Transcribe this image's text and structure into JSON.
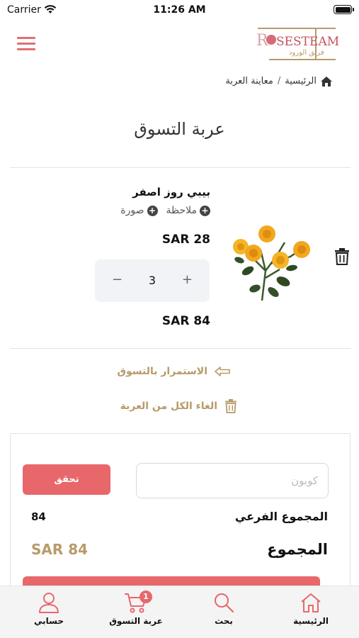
{
  "status_bar": {
    "carrier": "Carrier",
    "time": "11:26 AM"
  },
  "header": {
    "logo_text": "ROSESTEAM",
    "logo_arabic": "فريق الورود",
    "brand_color": "#e07070"
  },
  "breadcrumb": {
    "home": "الرئيسية",
    "separator": "/",
    "current": "معاينة العربة"
  },
  "page_title": "عربة التسوق",
  "cart_item": {
    "name": "بيبي روز اصفر",
    "note_label": "ملاحظة",
    "image_label": "صورة",
    "unit_price": "SAR 28",
    "quantity": "3",
    "line_total": "SAR 84"
  },
  "links": {
    "continue_shopping": "الاستمرار بالتسوق",
    "clear_cart": "الغاء الكل من العربة"
  },
  "summary": {
    "coupon_placeholder": "كوبون",
    "check_button": "تحقق",
    "subtotal_label": "المجموع الفرعي",
    "subtotal_value": "84",
    "total_label": "المجموع",
    "total_value": "SAR 84"
  },
  "tabbar": {
    "tabs": [
      {
        "label": "الرئيسية",
        "icon": "home-icon"
      },
      {
        "label": "بحث",
        "icon": "search-icon"
      },
      {
        "label": "عربة التسوق",
        "icon": "cart-icon",
        "badge": "1"
      },
      {
        "label": "حسابي",
        "icon": "user-icon"
      }
    ]
  },
  "colors": {
    "accent": "#e8676b",
    "gold": "#b89a6a"
  }
}
